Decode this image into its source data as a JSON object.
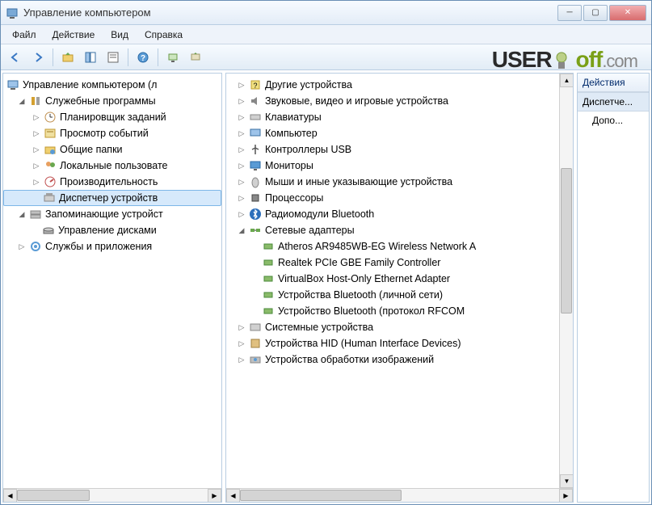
{
  "window": {
    "title": "Управление компьютером"
  },
  "menu": {
    "file": "Файл",
    "action": "Действие",
    "view": "Вид",
    "help": "Справка"
  },
  "watermark": {
    "user": "USER",
    "off": "off",
    "com": ".com"
  },
  "left_tree": {
    "root": "Управление компьютером (л",
    "system_tools": "Служебные программы",
    "task_scheduler": "Планировщик заданий",
    "event_viewer": "Просмотр событий",
    "shared_folders": "Общие папки",
    "local_users": "Локальные пользовате",
    "performance": "Производительность",
    "device_manager": "Диспетчер устройств",
    "storage": "Запоминающие устройст",
    "disk_mgmt": "Управление дисками",
    "services_apps": "Службы и приложения"
  },
  "mid_tree": {
    "other_devices": "Другие устройства",
    "sound": "Звуковые, видео и игровые устройства",
    "keyboards": "Клавиатуры",
    "computer": "Компьютер",
    "usb_controllers": "Контроллеры USB",
    "monitors": "Мониторы",
    "mice": "Мыши и иные указывающие устройства",
    "processors": "Процессоры",
    "bluetooth_radios": "Радиомодули Bluetooth",
    "network_adapters": "Сетевые адаптеры",
    "na_atheros": "Atheros AR9485WB-EG Wireless Network A",
    "na_realtek": "Realtek PCIe GBE Family Controller",
    "na_vbox": "VirtualBox Host-Only Ethernet Adapter",
    "na_bt_pan": "Устройства Bluetooth (личной сети)",
    "na_bt_rfcom": "Устройство Bluetooth (протокол RFCOM",
    "system_devices": "Системные устройства",
    "hid": "Устройства HID (Human Interface Devices)",
    "imaging": "Устройства обработки изображений"
  },
  "actions": {
    "header": "Действия",
    "dispatche": "Диспетче...",
    "dopo": "Допо..."
  }
}
